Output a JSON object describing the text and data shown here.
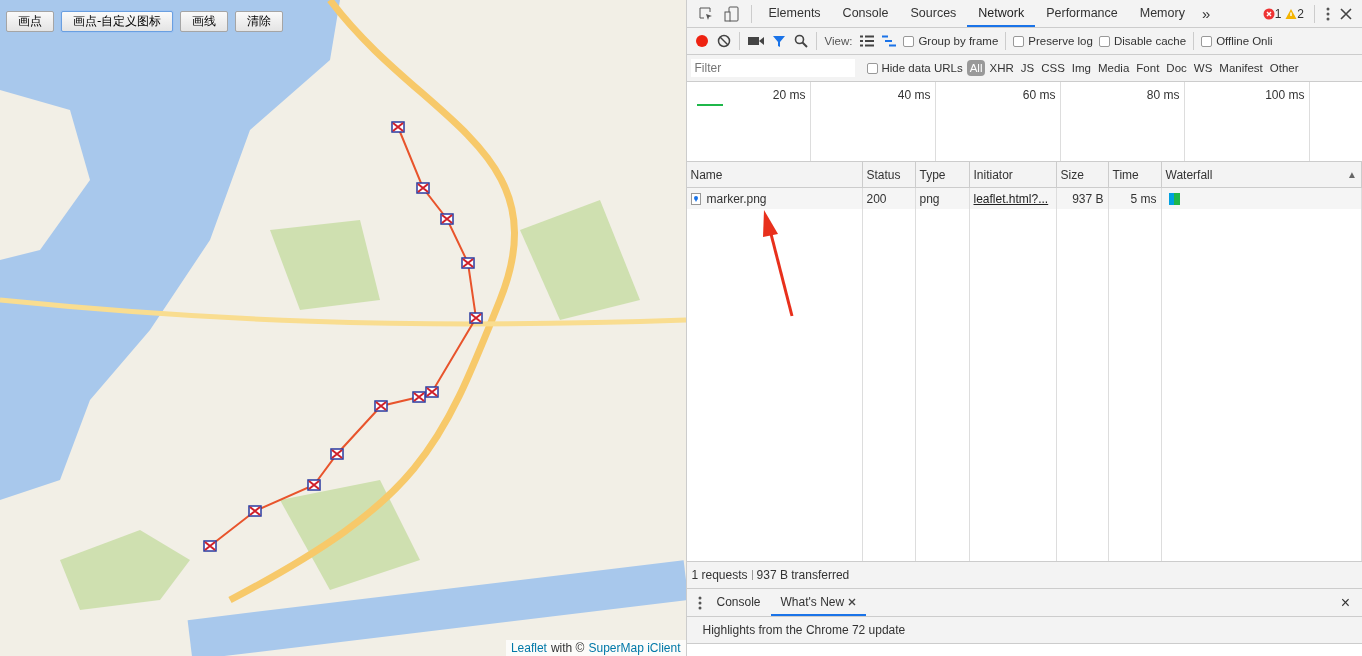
{
  "map": {
    "buttons": [
      {
        "label": "画点",
        "focused": false
      },
      {
        "label": "画点-自定义图标",
        "focused": true
      },
      {
        "label": "画线",
        "focused": false
      },
      {
        "label": "清除",
        "focused": false
      }
    ],
    "attribution": {
      "link_1": "Leaflet",
      "text": "with ©",
      "link_2": "SuperMap iClient"
    }
  },
  "devtools": {
    "tabs": [
      {
        "label": "Elements",
        "selected": false
      },
      {
        "label": "Console",
        "selected": false
      },
      {
        "label": "Sources",
        "selected": false
      },
      {
        "label": "Network",
        "selected": true
      },
      {
        "label": "Performance",
        "selected": false
      },
      {
        "label": "Memory",
        "selected": false
      }
    ],
    "overflow": "»",
    "errors": "1",
    "warnings": "2",
    "toolbar": {
      "recording": true,
      "filter_active": true,
      "view_label": "View:",
      "checkboxes": [
        {
          "label": "Group by frame",
          "checked": false
        },
        {
          "label": "Preserve log",
          "checked": false
        },
        {
          "label": "Disable cache",
          "checked": false
        },
        {
          "label": "Offline",
          "checked": false
        }
      ],
      "cut_off": "Onli"
    },
    "filter_bar": {
      "placeholder": "Filter",
      "hide_data_urls": {
        "label": "Hide data URLs",
        "checked": false
      },
      "types": [
        {
          "label": "All",
          "selected": true
        },
        {
          "label": "XHR",
          "selected": false
        },
        {
          "label": "JS",
          "selected": false
        },
        {
          "label": "CSS",
          "selected": false
        },
        {
          "label": "Img",
          "selected": false
        },
        {
          "label": "Media",
          "selected": false
        },
        {
          "label": "Font",
          "selected": false
        },
        {
          "label": "Doc",
          "selected": false
        },
        {
          "label": "WS",
          "selected": false
        },
        {
          "label": "Manifest",
          "selected": false
        },
        {
          "label": "Other",
          "selected": false
        }
      ]
    },
    "overview": {
      "ticks": [
        "20 ms",
        "40 ms",
        "60 ms",
        "80 ms",
        "100 ms"
      ]
    },
    "table": {
      "columns": [
        "Name",
        "Status",
        "Type",
        "Initiator",
        "Size",
        "Time",
        "Waterfall"
      ],
      "sort_indicator": "▲",
      "rows": [
        {
          "name": "marker.png",
          "status": "200",
          "type": "png",
          "initiator": "leaflet.html?...",
          "size": "937 B",
          "time": "5 ms"
        }
      ]
    },
    "summary": {
      "requests": "1 requests",
      "transferred": "937 B transferred"
    },
    "drawer": {
      "tabs": [
        {
          "label": "Console",
          "selected": false,
          "closable": false
        },
        {
          "label": "What's New",
          "selected": true,
          "closable": true
        }
      ],
      "close": "×",
      "content": "Highlights from the Chrome 72 update"
    }
  }
}
